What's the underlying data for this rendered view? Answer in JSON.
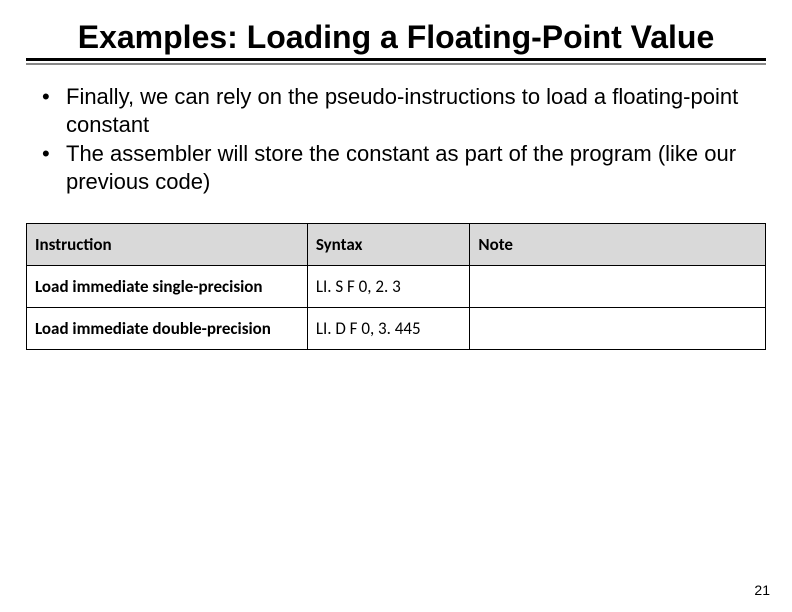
{
  "title": "Examples: Loading a Floating-Point Value",
  "bullets": [
    "Finally, we can rely on the pseudo-instructions to load a floating-point constant",
    "The assembler will store the constant as part of the program (like our previous code)"
  ],
  "table": {
    "headers": {
      "c1": "Instruction",
      "c2": "Syntax",
      "c3": "Note"
    },
    "rows": [
      {
        "instruction": "Load immediate single-precision",
        "syntax": "LI. S   F 0, 2. 3",
        "note": ""
      },
      {
        "instruction": "Load immediate double-precision",
        "syntax": "LI. D   F 0, 3. 445",
        "note": ""
      }
    ]
  },
  "page_number": "21"
}
